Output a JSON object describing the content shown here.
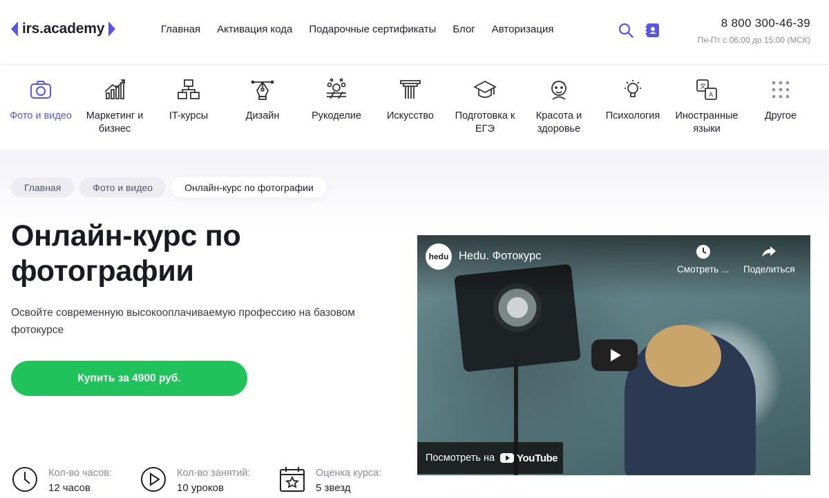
{
  "header": {
    "logo": "irs.academy",
    "nav": [
      "Главная",
      "Активация кода",
      "Подарочные сертификаты",
      "Блог",
      "Авторизация"
    ],
    "phone": "8 800 300-46-39",
    "hours": "Пн-Пт с 06:00 до 15:00 (МСК)",
    "icons": [
      "search-icon",
      "contacts-icon"
    ]
  },
  "categories": [
    {
      "label": "Фото и видео",
      "icon": "camera-icon",
      "active": true
    },
    {
      "label": "Маркетинг и бизнес",
      "icon": "chart-icon",
      "active": false
    },
    {
      "label": "IT-курсы",
      "icon": "network-icon",
      "active": false
    },
    {
      "label": "Дизайн",
      "icon": "pen-tool-icon",
      "active": false
    },
    {
      "label": "Рукоделие",
      "icon": "needlework-icon",
      "active": false
    },
    {
      "label": "Искусство",
      "icon": "column-icon",
      "active": false
    },
    {
      "label": "Подготовка к ЕГЭ",
      "icon": "graduation-cap-icon",
      "active": false
    },
    {
      "label": "Красота и здоровье",
      "icon": "face-icon",
      "active": false
    },
    {
      "label": "Психология",
      "icon": "lightbulb-icon",
      "active": false
    },
    {
      "label": "Иностранные языки",
      "icon": "translate-icon",
      "active": false
    },
    {
      "label": "Другое",
      "icon": "grid-dots-icon",
      "active": false
    }
  ],
  "breadcrumbs": [
    "Главная",
    "Фото и видео",
    "Онлайн-курс по фотографии"
  ],
  "course": {
    "title": "Онлайн-курс по фотографии",
    "subtitle": "Освойте современную высокооплачиваемую профессию на базовом фотокурсе",
    "buy_label": "Купить за 4900 руб."
  },
  "stats": [
    {
      "label": "Кол-во часов:",
      "value": "12 часов",
      "icon": "clock-icon"
    },
    {
      "label": "Кол-во занятий:",
      "value": "10 уроков",
      "icon": "play-circle-icon"
    },
    {
      "label": "Оценка курса:",
      "value": "5 звезд",
      "icon": "calendar-star-icon"
    }
  ],
  "video": {
    "channel": "hedu",
    "title": "Hedu. Фотокурс",
    "watch_later": "Смотреть ...",
    "share": "Поделиться",
    "watch_on": "Посмотреть на",
    "youtube": "YouTube"
  },
  "colors": {
    "accent": "#5b54e8",
    "buy": "#1fc25b",
    "text": "#1f1f2b"
  }
}
